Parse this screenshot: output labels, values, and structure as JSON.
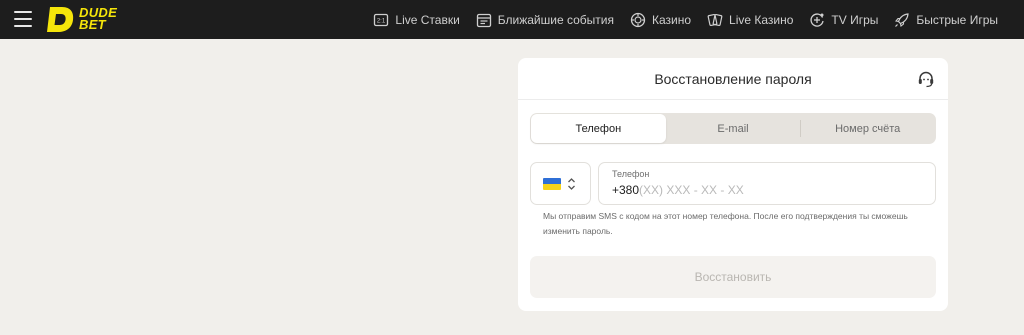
{
  "header": {
    "logo_line1": "DUDE",
    "logo_line2": "BET",
    "nav": [
      {
        "label": "Live Ставки",
        "icon": "live-bets-icon"
      },
      {
        "label": "Ближайшие события",
        "icon": "calendar-icon"
      },
      {
        "label": "Казино",
        "icon": "casino-chip-icon"
      },
      {
        "label": "Live Казино",
        "icon": "cards-icon"
      },
      {
        "label": "TV Игры",
        "icon": "tv-games-icon"
      },
      {
        "label": "Быстрые Игры",
        "icon": "rocket-icon"
      }
    ]
  },
  "recovery": {
    "title": "Восстановление пароля",
    "tabs": [
      {
        "label": "Телефон",
        "active": true
      },
      {
        "label": "E-mail",
        "active": false
      },
      {
        "label": "Номер счёта",
        "active": false
      }
    ],
    "country": {
      "flag": "ukraine-flag-icon"
    },
    "phone": {
      "label": "Телефон",
      "prefix": "+380",
      "mask": "(XX) XXX - XX - XX"
    },
    "hint": "Мы отправим SMS с кодом на этот номер телефона. После его подтверждения ты сможешь изменить пароль.",
    "submit_label": "Восстановить"
  },
  "colors": {
    "topbar": "#1d1d1d",
    "brand_yellow": "#f5e50a",
    "page_bg": "#f1efeb"
  }
}
